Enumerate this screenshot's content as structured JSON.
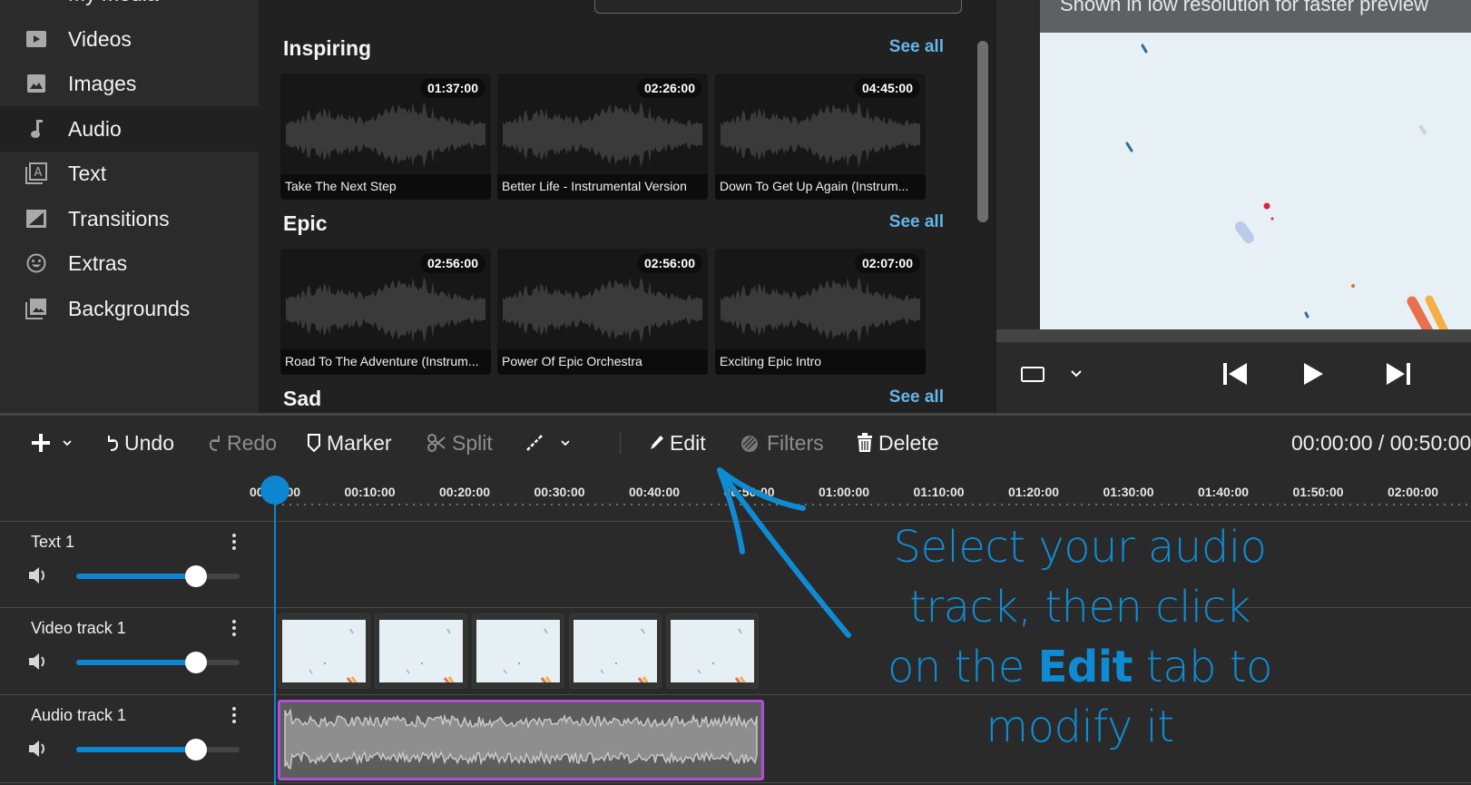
{
  "sidebar": {
    "items": [
      {
        "label": "My media",
        "icon": "folder-icon",
        "active": false
      },
      {
        "label": "Videos",
        "icon": "video-icon",
        "active": false
      },
      {
        "label": "Images",
        "icon": "image-icon",
        "active": false
      },
      {
        "label": "Audio",
        "icon": "music-note-icon",
        "active": true
      },
      {
        "label": "Text",
        "icon": "text-icon",
        "active": false
      },
      {
        "label": "Transitions",
        "icon": "transition-icon",
        "active": false
      },
      {
        "label": "Extras",
        "icon": "smiley-icon",
        "active": false
      },
      {
        "label": "Backgrounds",
        "icon": "backgrounds-icon",
        "active": false
      }
    ]
  },
  "library": {
    "sections": [
      {
        "title": "Inspiring",
        "see_all": "See all",
        "tracks": [
          {
            "title": "Take The Next Step",
            "duration": "01:37:00"
          },
          {
            "title": "Better Life - Instrumental Version",
            "duration": "02:26:00"
          },
          {
            "title": "Down To Get Up Again (Instrum...",
            "duration": "04:45:00"
          }
        ]
      },
      {
        "title": "Epic",
        "see_all": "See all",
        "tracks": [
          {
            "title": "Road To The Adventure (Instrum...",
            "duration": "02:56:00"
          },
          {
            "title": "Power Of Epic Orchestra",
            "duration": "02:56:00"
          },
          {
            "title": "Exciting Epic Intro",
            "duration": "02:07:00"
          }
        ]
      },
      {
        "title": "Sad",
        "see_all": "See all",
        "tracks": []
      }
    ]
  },
  "preview": {
    "banner": "Shown in low resolution for faster preview",
    "aspect_icon": "aspect-ratio-icon",
    "controls": {
      "prev": "skip-back-icon",
      "play": "play-icon",
      "next": "skip-forward-icon"
    }
  },
  "toolbar": {
    "add": "+",
    "undo": "Undo",
    "redo": "Redo",
    "marker": "Marker",
    "split": "Split",
    "edit": "Edit",
    "filters": "Filters",
    "delete": "Delete",
    "timecode": "00:00:00 / 00:50:00"
  },
  "ruler": {
    "ticks": [
      "00:00:00",
      "00:10:00",
      "00:20:00",
      "00:30:00",
      "00:40:00",
      "00:50:00",
      "01:00:00",
      "01:10:00",
      "01:20:00",
      "01:30:00",
      "01:40:00",
      "01:50:00",
      "02:00:00"
    ]
  },
  "tracks": [
    {
      "name": "Text 1",
      "volume": 0.77
    },
    {
      "name": "Video track 1",
      "volume": 0.77
    },
    {
      "name": "Audio track 1",
      "volume": 0.77
    }
  ],
  "annotation": {
    "line1": "Select your audio",
    "line2": "track, then click",
    "line3_pre": "on the ",
    "line3_bold": "Edit",
    "line3_post": " tab to",
    "line4": "modify it"
  },
  "colors": {
    "accent": "#0c86d1",
    "link": "#64b6e8",
    "selection": "#b04fd6"
  }
}
